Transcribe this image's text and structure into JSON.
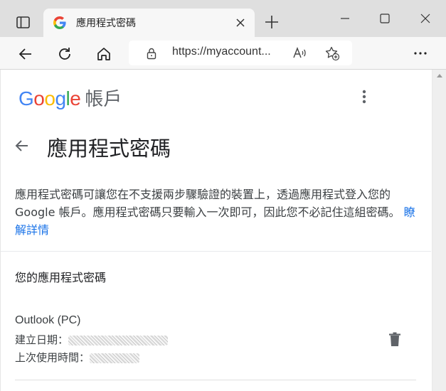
{
  "browser": {
    "tab": {
      "title": "應用程式密碼"
    },
    "address_bar": {
      "url": "https://myaccount..."
    }
  },
  "page": {
    "logo": {
      "letters": [
        "G",
        "o",
        "o",
        "g",
        "l",
        "e"
      ],
      "product": "帳戶"
    },
    "title": "應用程式密碼",
    "description": "應用程式密碼可讓您在不支援兩步驟驗證的裝置上，透過應用程式登入您的 Google 帳戶。應用程式密碼只要輸入一次即可，因此您不必記住這組密碼。",
    "learn_more": "瞭解詳情",
    "section_heading": "您的應用程式密碼",
    "passwords": [
      {
        "name": "Outlook (PC)",
        "created_label": "建立日期：",
        "last_used_label": "上次使用時間："
      }
    ]
  },
  "colors": {
    "accent": "#1a73e8",
    "google_blue": "#4285f4",
    "google_red": "#ea4335",
    "google_yellow": "#fbbc05",
    "google_green": "#34a853"
  },
  "icons": {
    "tab_actions": "tab-actions-icon",
    "favicon": "google-favicon-icon",
    "close_tab": "close-icon",
    "new_tab": "plus-icon",
    "minimize": "minimize-icon",
    "maximize": "maximize-icon",
    "close_window": "close-icon",
    "back": "arrow-left-icon",
    "refresh": "refresh-icon",
    "home": "home-icon",
    "lock": "lock-icon",
    "read_aloud": "read-aloud-icon",
    "add_favorite": "star-plus-icon",
    "browser_menu": "more-horizontal-icon",
    "page_menu": "more-vertical-icon",
    "page_back": "arrow-left-icon",
    "delete": "trash-icon"
  }
}
